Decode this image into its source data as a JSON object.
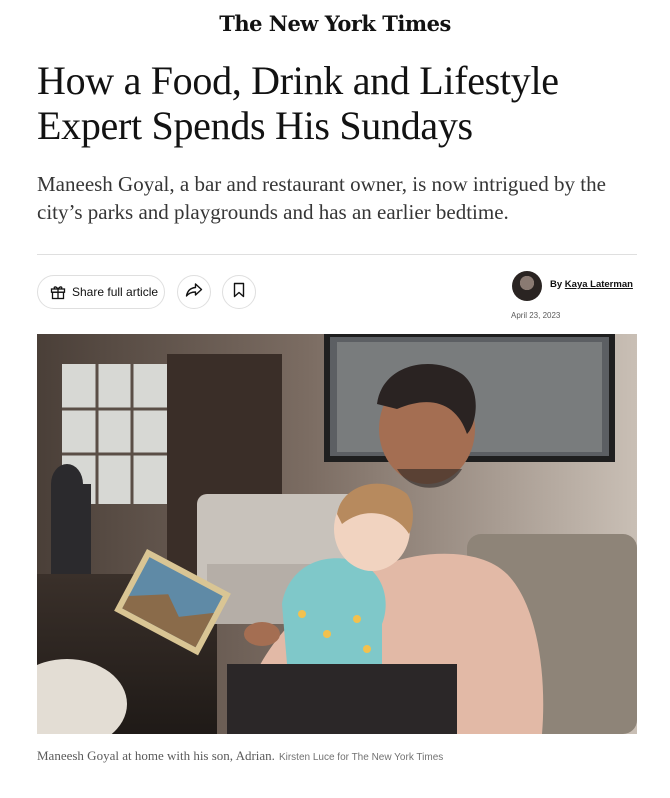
{
  "masthead": {
    "title": "The New York Times"
  },
  "article": {
    "headline": "How a Food, Drink and Lifestyle Expert Spends His Sundays",
    "summary": "Maneesh Goyal, a bar and restaurant owner, is now intrigued by the city’s parks and playgrounds and has an earlier bedtime."
  },
  "toolbar": {
    "share_full_article_label": "Share full article",
    "share_icon": "share-arrow-icon",
    "save_icon": "bookmark-icon",
    "gift_icon": "gift-icon"
  },
  "byline": {
    "prefix": "By",
    "author": "Kaya Laterman",
    "date": "April 23, 2023"
  },
  "photo": {
    "caption": "Maneesh Goyal at home with his son, Adrian.",
    "credit": "Kirsten Luce for The New York Times"
  },
  "colors": {
    "text": "#121212",
    "summary": "#363636",
    "caption": "#5a5a5a",
    "border": "#dfdfdf"
  }
}
